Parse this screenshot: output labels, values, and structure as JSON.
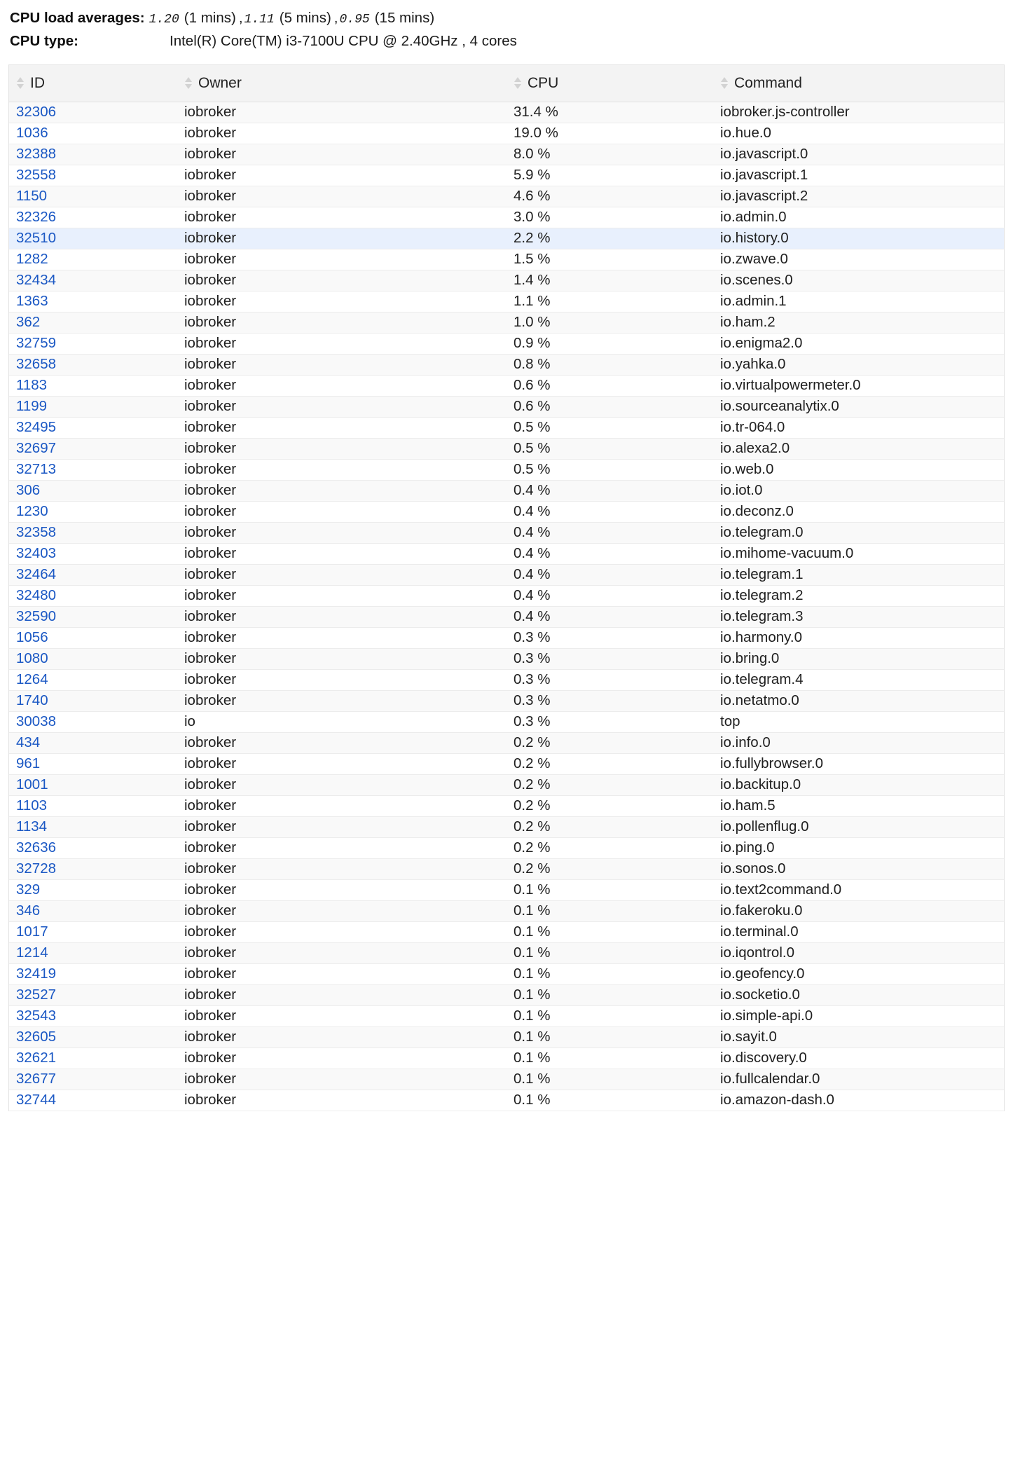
{
  "header": {
    "load_label": "CPU load averages:",
    "load": [
      {
        "value": "1.20",
        "window": "(1 mins)"
      },
      {
        "value": "1.11",
        "window": "(5 mins)"
      },
      {
        "value": "0.95",
        "window": "(15 mins)"
      }
    ],
    "cpu_type_label": "CPU type:",
    "cpu_type_value": "Intel(R) Core(TM) i3-7100U CPU @ 2.40GHz , 4 cores"
  },
  "table": {
    "columns": [
      {
        "key": "id",
        "label": "ID",
        "sort_icon": "sort-updown-icon"
      },
      {
        "key": "owner",
        "label": "Owner",
        "sort_icon": "sort-updown-icon"
      },
      {
        "key": "cpu",
        "label": "CPU",
        "sort_icon": "sort-updown-icon"
      },
      {
        "key": "command",
        "label": "Command",
        "sort_icon": "sort-updown-icon"
      }
    ],
    "selected_row_id": "32510",
    "selected_row_color": "#e8f0fd",
    "id_link_color": "#1b58c4",
    "rows": [
      {
        "id": "32306",
        "owner": "iobroker",
        "cpu": "31.4 %",
        "command": "iobroker.js-controller"
      },
      {
        "id": "1036",
        "owner": "iobroker",
        "cpu": "19.0 %",
        "command": "io.hue.0"
      },
      {
        "id": "32388",
        "owner": "iobroker",
        "cpu": "8.0 %",
        "command": "io.javascript.0"
      },
      {
        "id": "32558",
        "owner": "iobroker",
        "cpu": "5.9 %",
        "command": "io.javascript.1"
      },
      {
        "id": "1150",
        "owner": "iobroker",
        "cpu": "4.6 %",
        "command": "io.javascript.2"
      },
      {
        "id": "32326",
        "owner": "iobroker",
        "cpu": "3.0 %",
        "command": "io.admin.0"
      },
      {
        "id": "32510",
        "owner": "iobroker",
        "cpu": "2.2 %",
        "command": "io.history.0"
      },
      {
        "id": "1282",
        "owner": "iobroker",
        "cpu": "1.5 %",
        "command": "io.zwave.0"
      },
      {
        "id": "32434",
        "owner": "iobroker",
        "cpu": "1.4 %",
        "command": "io.scenes.0"
      },
      {
        "id": "1363",
        "owner": "iobroker",
        "cpu": "1.1 %",
        "command": "io.admin.1"
      },
      {
        "id": "362",
        "owner": "iobroker",
        "cpu": "1.0 %",
        "command": "io.ham.2"
      },
      {
        "id": "32759",
        "owner": "iobroker",
        "cpu": "0.9 %",
        "command": "io.enigma2.0"
      },
      {
        "id": "32658",
        "owner": "iobroker",
        "cpu": "0.8 %",
        "command": "io.yahka.0"
      },
      {
        "id": "1183",
        "owner": "iobroker",
        "cpu": "0.6 %",
        "command": "io.virtualpowermeter.0"
      },
      {
        "id": "1199",
        "owner": "iobroker",
        "cpu": "0.6 %",
        "command": "io.sourceanalytix.0"
      },
      {
        "id": "32495",
        "owner": "iobroker",
        "cpu": "0.5 %",
        "command": "io.tr-064.0"
      },
      {
        "id": "32697",
        "owner": "iobroker",
        "cpu": "0.5 %",
        "command": "io.alexa2.0"
      },
      {
        "id": "32713",
        "owner": "iobroker",
        "cpu": "0.5 %",
        "command": "io.web.0"
      },
      {
        "id": "306",
        "owner": "iobroker",
        "cpu": "0.4 %",
        "command": "io.iot.0"
      },
      {
        "id": "1230",
        "owner": "iobroker",
        "cpu": "0.4 %",
        "command": "io.deconz.0"
      },
      {
        "id": "32358",
        "owner": "iobroker",
        "cpu": "0.4 %",
        "command": "io.telegram.0"
      },
      {
        "id": "32403",
        "owner": "iobroker",
        "cpu": "0.4 %",
        "command": "io.mihome-vacuum.0"
      },
      {
        "id": "32464",
        "owner": "iobroker",
        "cpu": "0.4 %",
        "command": "io.telegram.1"
      },
      {
        "id": "32480",
        "owner": "iobroker",
        "cpu": "0.4 %",
        "command": "io.telegram.2"
      },
      {
        "id": "32590",
        "owner": "iobroker",
        "cpu": "0.4 %",
        "command": "io.telegram.3"
      },
      {
        "id": "1056",
        "owner": "iobroker",
        "cpu": "0.3 %",
        "command": "io.harmony.0"
      },
      {
        "id": "1080",
        "owner": "iobroker",
        "cpu": "0.3 %",
        "command": "io.bring.0"
      },
      {
        "id": "1264",
        "owner": "iobroker",
        "cpu": "0.3 %",
        "command": "io.telegram.4"
      },
      {
        "id": "1740",
        "owner": "iobroker",
        "cpu": "0.3 %",
        "command": "io.netatmo.0"
      },
      {
        "id": "30038",
        "owner": "io",
        "cpu": "0.3 %",
        "command": "top"
      },
      {
        "id": "434",
        "owner": "iobroker",
        "cpu": "0.2 %",
        "command": "io.info.0"
      },
      {
        "id": "961",
        "owner": "iobroker",
        "cpu": "0.2 %",
        "command": "io.fullybrowser.0"
      },
      {
        "id": "1001",
        "owner": "iobroker",
        "cpu": "0.2 %",
        "command": "io.backitup.0"
      },
      {
        "id": "1103",
        "owner": "iobroker",
        "cpu": "0.2 %",
        "command": "io.ham.5"
      },
      {
        "id": "1134",
        "owner": "iobroker",
        "cpu": "0.2 %",
        "command": "io.pollenflug.0"
      },
      {
        "id": "32636",
        "owner": "iobroker",
        "cpu": "0.2 %",
        "command": "io.ping.0"
      },
      {
        "id": "32728",
        "owner": "iobroker",
        "cpu": "0.2 %",
        "command": "io.sonos.0"
      },
      {
        "id": "329",
        "owner": "iobroker",
        "cpu": "0.1 %",
        "command": "io.text2command.0"
      },
      {
        "id": "346",
        "owner": "iobroker",
        "cpu": "0.1 %",
        "command": "io.fakeroku.0"
      },
      {
        "id": "1017",
        "owner": "iobroker",
        "cpu": "0.1 %",
        "command": "io.terminal.0"
      },
      {
        "id": "1214",
        "owner": "iobroker",
        "cpu": "0.1 %",
        "command": "io.iqontrol.0"
      },
      {
        "id": "32419",
        "owner": "iobroker",
        "cpu": "0.1 %",
        "command": "io.geofency.0"
      },
      {
        "id": "32527",
        "owner": "iobroker",
        "cpu": "0.1 %",
        "command": "io.socketio.0"
      },
      {
        "id": "32543",
        "owner": "iobroker",
        "cpu": "0.1 %",
        "command": "io.simple-api.0"
      },
      {
        "id": "32605",
        "owner": "iobroker",
        "cpu": "0.1 %",
        "command": "io.sayit.0"
      },
      {
        "id": "32621",
        "owner": "iobroker",
        "cpu": "0.1 %",
        "command": "io.discovery.0"
      },
      {
        "id": "32677",
        "owner": "iobroker",
        "cpu": "0.1 %",
        "command": "io.fullcalendar.0"
      },
      {
        "id": "32744",
        "owner": "iobroker",
        "cpu": "0.1 %",
        "command": "io.amazon-dash.0"
      }
    ]
  }
}
